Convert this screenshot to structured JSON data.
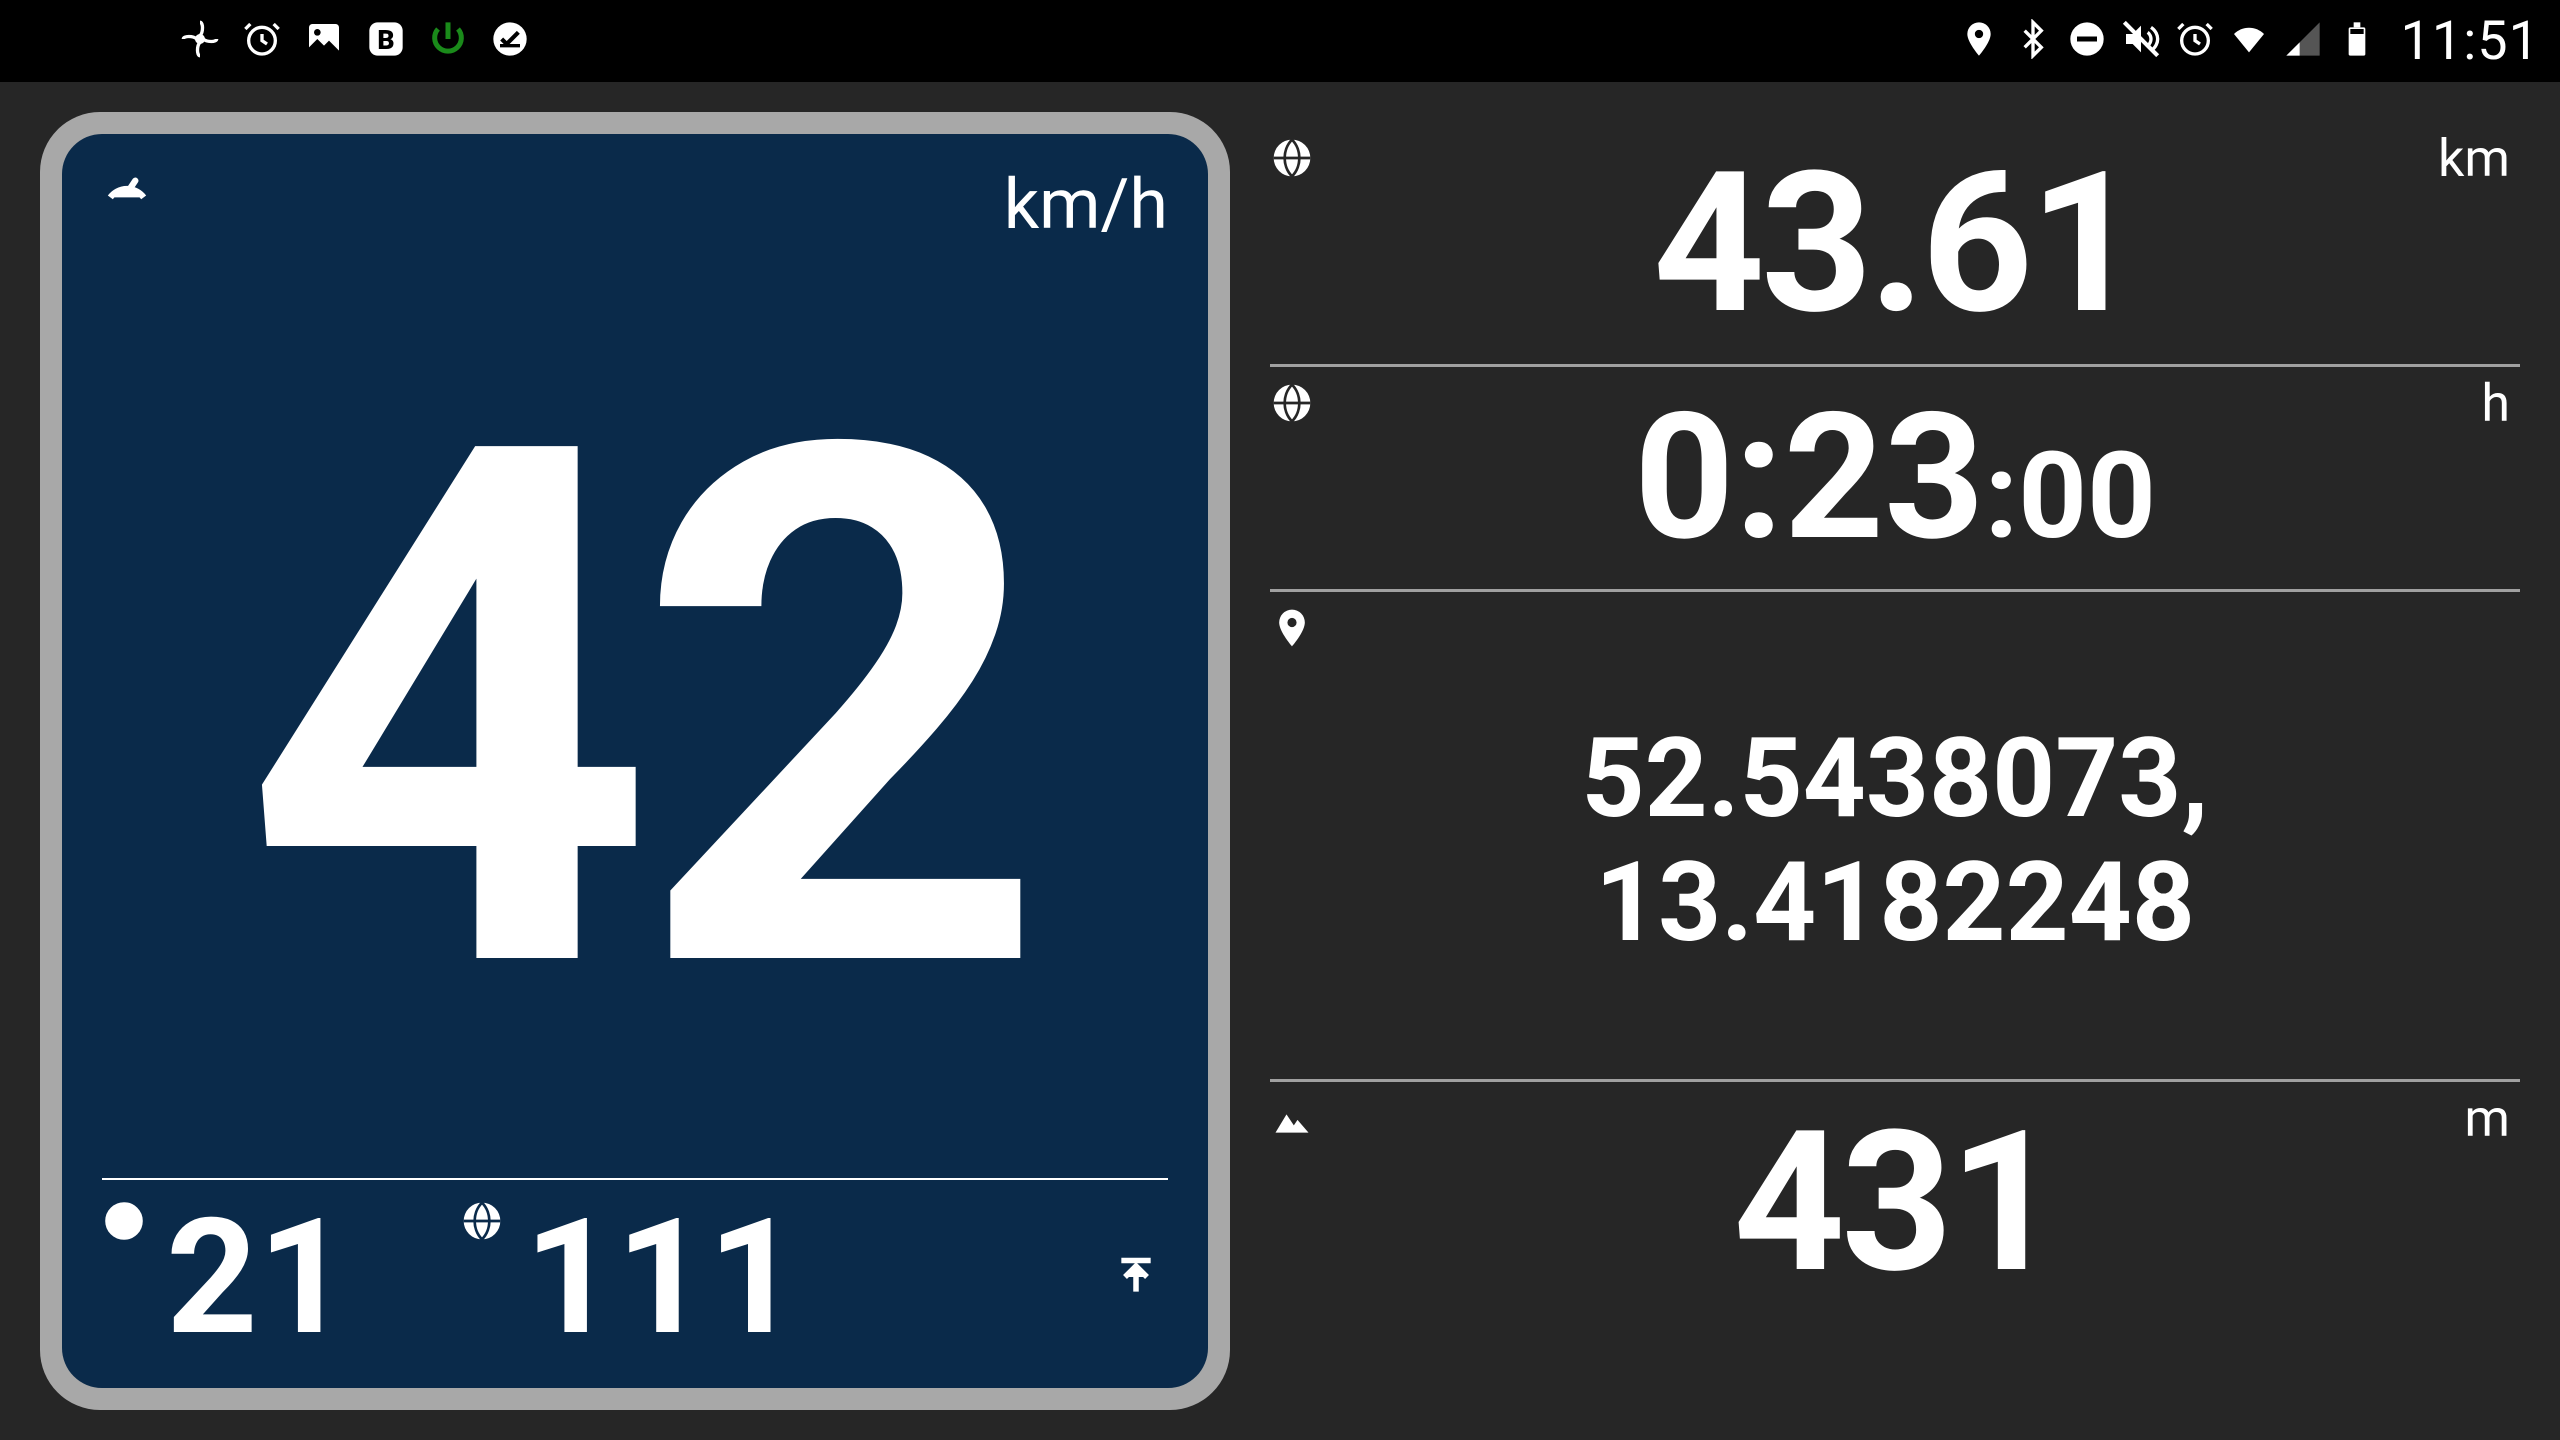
{
  "status": {
    "time": "11:51"
  },
  "speed": {
    "unit": "km/h",
    "value": "42",
    "avg": "21",
    "max": "111"
  },
  "distance": {
    "value": "43.61",
    "unit": "km"
  },
  "time": {
    "main": "0:23",
    "seconds": ":00",
    "unit": "h"
  },
  "coords": {
    "lat": "52.5438073,",
    "lon": "13.4182248"
  },
  "elevation": {
    "value": "431",
    "unit": "m"
  }
}
